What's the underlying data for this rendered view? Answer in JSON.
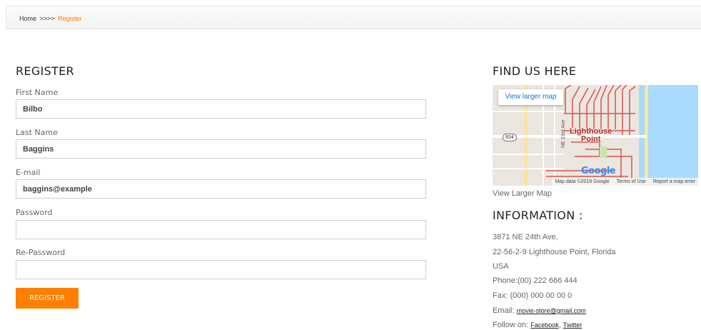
{
  "breadcrumb": {
    "home": "Home",
    "separator": ">>>>",
    "current": "Register"
  },
  "register": {
    "title": "REGISTER",
    "fields": [
      {
        "label": "First Name",
        "value": "Bilbo"
      },
      {
        "label": "Last Name",
        "value": "Baggins"
      },
      {
        "label": "E-mail",
        "value": "baggins@example"
      },
      {
        "label": "Password",
        "value": ""
      },
      {
        "label": "Re-Password",
        "value": ""
      }
    ],
    "button_label": "REGISTER"
  },
  "find_us": {
    "title": "FIND US HERE",
    "map": {
      "view_larger_button": "View larger map",
      "place_label_line1": "Lighthouse",
      "place_label_line2": "Point",
      "road_shield": "834",
      "street_label": "NE 23rd Ave",
      "logo": "Google",
      "attribution": "Map data ©2019 Google",
      "terms": "Terms of Use",
      "report": "Report a map error"
    },
    "view_larger_link": "View Larger Map"
  },
  "information": {
    "title": "INFORMATION :",
    "address_line1": "3871 NE 24th Ave,",
    "address_line2": "22-56-2-9 Lighthouse Point, Florida",
    "country": "USA",
    "phone": "Phone:(00) 222 666 444",
    "fax": "Fax: (000) 000 00 00 0",
    "email_prefix": "Email: ",
    "email": "movie-store@gmail.com",
    "follow_prefix": "Follow on: ",
    "facebook": "Facebook",
    "follow_separator": ", ",
    "twitter": "Twitter"
  },
  "colors": {
    "accent": "#ff7f00",
    "breadcrumb_current": "#ff7a00",
    "map_water": "#aadaff",
    "map_land": "#ebe6df"
  }
}
